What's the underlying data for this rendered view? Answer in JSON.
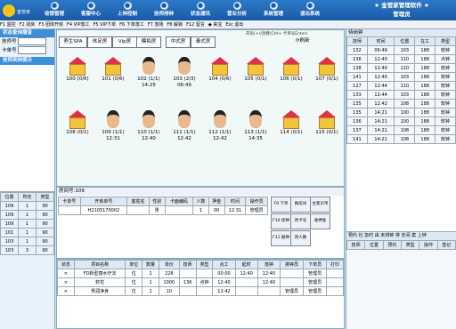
{
  "toolbar": {
    "items": [
      {
        "label": "收银管理",
        "icon": "cash-icon"
      },
      {
        "label": "客服中心",
        "icon": "service-icon"
      },
      {
        "label": "上钟控制",
        "icon": "clock-icon"
      },
      {
        "label": "技师排钟",
        "icon": "tech-icon"
      },
      {
        "label": "状态通讯",
        "icon": "comm-icon"
      },
      {
        "label": "营业分析",
        "icon": "chart-icon"
      },
      {
        "label": "系统管理",
        "icon": "gear-icon"
      },
      {
        "label": "退出系统",
        "icon": "exit-icon"
      }
    ],
    "brand_title": "★ 金管家管理软件 ★",
    "brand_sub": "管理员",
    "date": "2011-06-03",
    "user": "A班"
  },
  "hotkeys": [
    "F1 监控",
    "F2 找房",
    "F3 团体开房",
    "F4 VIP落工",
    "F5 VIP下单",
    "F6 下单落工",
    "F7 落场",
    "F8 解锁",
    "F12 留言",
    "◆ 来宝",
    "Esc 退出"
  ],
  "left": {
    "header": "状态查询播音",
    "tech_label": "技师号",
    "card_label": "卡单号",
    "report_header": "技师到钟提示",
    "table_headers": [
      "位置",
      "所定",
      "类型"
    ],
    "table_rows": [
      [
        "109",
        "1",
        "90"
      ],
      [
        "109",
        "1",
        "90"
      ],
      [
        "109",
        "1",
        "90"
      ],
      [
        "101",
        "1",
        "90"
      ],
      [
        "103",
        "1",
        "90"
      ],
      [
        "103",
        "3",
        "90"
      ]
    ]
  },
  "rooms": {
    "tabs": [
      "养生SPA",
      "休足房",
      "Vip房",
      "模拟房",
      "中式房",
      "泰式房"
    ],
    "refresh": "刷新",
    "hint": "开房(+)/消费(Ctrl+ 卡单号Enter)",
    "row1": [
      {
        "label": "100 (0/6)",
        "time": "",
        "type": "house"
      },
      {
        "label": "101 (0/6)",
        "time": "",
        "type": "house"
      },
      {
        "label": "102 (1/1)",
        "time": "14:25",
        "type": "face"
      },
      {
        "label": "103 (2/3)",
        "time": "06:49",
        "type": "face"
      },
      {
        "label": "104 (0/6)",
        "time": "",
        "type": "house"
      },
      {
        "label": "105 (0/1)",
        "time": "",
        "type": "house"
      },
      {
        "label": "106 (0/1)",
        "time": "",
        "type": "house"
      },
      {
        "label": "107 (0/1)",
        "time": "",
        "type": "house"
      }
    ],
    "row2": [
      {
        "label": "108 (0/1)",
        "time": "",
        "type": "house"
      },
      {
        "label": "109 (1/1)",
        "time": "12:31",
        "type": "face"
      },
      {
        "label": "110 (1/1)",
        "time": "12:40",
        "type": "face"
      },
      {
        "label": "111 (1/1)",
        "time": "12:42",
        "type": "face"
      },
      {
        "label": "112 (1/1)",
        "time": "12:42",
        "type": "face"
      },
      {
        "label": "113 (1/1)",
        "time": "14:35",
        "type": "face"
      },
      {
        "label": "114 (0/1)",
        "time": "",
        "type": "house"
      },
      {
        "label": "115 (0/1)",
        "time": "",
        "type": "house"
      }
    ]
  },
  "orders": {
    "title": "房间号:109",
    "headers": [
      "卡单号",
      "开房单号",
      "客姓名",
      "性别",
      "卡面编码",
      "人数",
      "押金",
      "时间",
      "操作员"
    ],
    "rows": [
      [
        "",
        "H2105170002",
        "",
        "男",
        "",
        "1",
        "00",
        "12:31",
        "管理员"
      ]
    ],
    "buttons": [
      "F9 下单",
      "换房间",
      "主客买单",
      "F10 续钟",
      "改卡号",
      "收押金",
      "F11 报钟",
      "改人数"
    ]
  },
  "items": {
    "headers": [
      "状态",
      "项目名称",
      "单位",
      "数量",
      "单价",
      "技师",
      "类型",
      "点工",
      "起时",
      "落钟",
      "排钟员",
      "下单员",
      "打印"
    ],
    "rows": [
      [
        "n",
        "FD新型丽水疗法",
        "位",
        "1",
        "228",
        "",
        "",
        "00:00",
        "12:40",
        "12:40",
        "",
        "管理员",
        ""
      ],
      [
        "n",
        "软花",
        "位",
        "1",
        "1000",
        "136",
        "点钟",
        "12:40",
        "",
        "12:40",
        "",
        "管理员",
        ""
      ],
      [
        "n",
        "男润净身",
        "位",
        "1",
        "10",
        "",
        "",
        "12:42",
        "",
        "",
        "管理员",
        "管理员",
        ""
      ]
    ]
  },
  "right": {
    "header": "待岗钟",
    "headers": [
      "技师",
      "时间",
      "位置",
      "在工",
      "类型"
    ],
    "rows": [
      [
        "132",
        "06:49",
        "103",
        "188",
        "软钟"
      ],
      [
        "136",
        "12:40",
        "110",
        "188",
        "点钟"
      ],
      [
        "138",
        "12:40",
        "110",
        "188",
        "软钟"
      ],
      [
        "141",
        "12:40",
        "103",
        "188",
        "软钟"
      ],
      [
        "127",
        "12:44",
        "110",
        "188",
        "软钟"
      ],
      [
        "133",
        "12:44",
        "103",
        "188",
        "软钟"
      ],
      [
        "135",
        "12:42",
        "108",
        "188",
        "软钟"
      ],
      [
        "135",
        "14:21",
        "100",
        "188",
        "软钟"
      ],
      [
        "136",
        "14:21",
        "100",
        "188",
        "软钟"
      ],
      [
        "137",
        "14:21",
        "108",
        "188",
        "软钟"
      ],
      [
        "141",
        "14:21",
        "108",
        "188",
        "软钟"
      ]
    ],
    "tabs_line": "预约 社 急时 由 未排钟 排 定间 案 上钟",
    "headers2": [
      "技师",
      "位置",
      "预约",
      "类型",
      "操作",
      "签记"
    ]
  }
}
